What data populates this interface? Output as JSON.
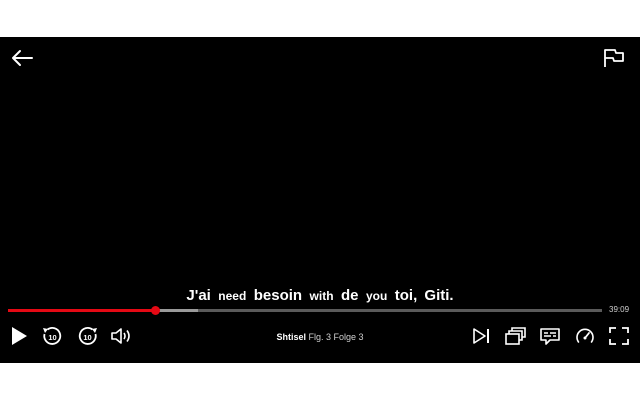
{
  "player": {
    "subtitle": {
      "words": [
        {
          "text": "J'ai",
          "size": "lg"
        },
        {
          "text": "need",
          "size": "sm"
        },
        {
          "text": "besoin",
          "size": "lg"
        },
        {
          "text": "with",
          "size": "sm"
        },
        {
          "text": "de",
          "size": "lg"
        },
        {
          "text": "you",
          "size": "sm"
        },
        {
          "text": "toi, Giti.",
          "size": "lg"
        }
      ]
    },
    "progress": {
      "played_fraction": 0.248,
      "buffered_fraction": 0.32,
      "time_remaining": "39:09",
      "accent_color": "#e50914"
    },
    "title": {
      "show": "Shtisel",
      "season": "Flg. 3",
      "episode": "Folge 3"
    },
    "controls": {
      "skip_amount": "10",
      "icons": [
        "back-arrow-icon",
        "report-flag-icon",
        "play-icon",
        "rewind-10-icon",
        "forward-10-icon",
        "volume-icon",
        "next-episode-icon",
        "episodes-icon",
        "subtitles-icon",
        "playback-speed-icon",
        "fullscreen-icon"
      ]
    }
  }
}
